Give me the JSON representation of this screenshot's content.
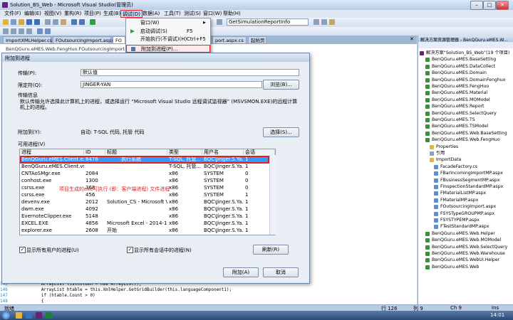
{
  "window": {
    "title": "Solution_BS_Web - Microsoft Visual Studio(管理员)"
  },
  "menu": [
    "文件(F)",
    "编辑(E)",
    "视图(V)",
    "重构(R)",
    "项目(P)",
    "生成(B)",
    "调试(D)",
    "数据(A)",
    "工具(T)",
    "测试(S)",
    "窗口(W)",
    "帮助(H)"
  ],
  "toolbar": {
    "config": "GetSimulationReportInfo"
  },
  "debug_menu": [
    {
      "label": "窗口(W)",
      "shortcut": "",
      "arrow": "▶"
    },
    {
      "label": "启动调试(S)",
      "shortcut": "F5"
    },
    {
      "label": "开始执行(不调试)(H)",
      "shortcut": "Ctrl+F5"
    },
    {
      "label": "附加到进程(P)...",
      "shortcut": ""
    }
  ],
  "tabs": [
    "ImportXMLHelper.cs",
    "FOutsourcingImport.aspx",
    "FO",
    "port.aspx.cs",
    "起始页"
  ],
  "tab_path": "BenQGuru.eMES.Web.FengHuo.FOutsourcingImport",
  "dialog": {
    "title": "附加到进程",
    "transport_label": "传输(P):",
    "transport_value": "默认值",
    "qualifier_label": "限定符(Q):",
    "qualifier_value": "JINGER-YAN",
    "browse_button": "浏览(B)...",
    "info_title": "传输信息",
    "info_text": "默认传输允许选择此计算机上的进程，或选择运行 “Microsoft Visual Studio 远程调试监视器” (MSVSMON.EXE)的远程计算机上的进程。",
    "attach_to_label": "附加到(Y):",
    "attach_to_value": "自动: T-SQL 代码, 托管 代码",
    "select_button": "选择(S)...",
    "available_label": "可用进程(V)",
    "columns": [
      "进程",
      "ID",
      "标题",
      "类型",
      "用户名",
      "会话"
    ],
    "rows": [
      [
        "BenQGuru.eMES.Client.exe",
        "8476",
        "",
        "T-SQL, 托管...",
        "BQC\\Jinger.S.Ya...",
        "1"
      ],
      [
        "BenQGuru.eMES.Client.vshost.exe",
        "",
        "",
        "T-SQL, 托管...",
        "BQC\\Jinger.S.Ya...",
        "1"
      ],
      [
        "CNTAoSMgr.exe",
        "2084",
        "",
        "x86",
        "SYSTEM",
        "0"
      ],
      [
        "conhost.exe",
        "1300",
        "",
        "x86",
        "SYSTEM",
        "0"
      ],
      [
        "csrss.exe",
        "368",
        "",
        "x86",
        "SYSTEM",
        "0"
      ],
      [
        "csrss.exe",
        "456",
        "",
        "x86",
        "SYSTEM",
        "1"
      ],
      [
        "devenv.exe",
        "2012",
        "Solution_CS - Microsoft Vis...",
        "x86",
        "BQC\\Jinger.S.Ya...",
        "1"
      ],
      [
        "dwm.exe",
        "4092",
        "",
        "x86",
        "BQC\\Jinger.S.Ya...",
        "1"
      ],
      [
        "EvernoteClipper.exe",
        "5148",
        "",
        "x86",
        "BQC\\Jinger.S.Ya...",
        "1"
      ],
      [
        "EXCEL.EXE",
        "4856",
        "Microsoft Excel - 2014-10-...",
        "x86",
        "BQC\\Jinger.S.Ya...",
        "1"
      ],
      [
        "explorer.exe",
        "2608",
        "开始",
        "x86",
        "BQC\\Jinger.S.Ya...",
        "1"
      ]
    ],
    "row0_title": "执行系统",
    "annotation": "项目生成的exe可执行 (即：客户端进程) 文件进程",
    "show_all_users": "显示所有用户的进程(U)",
    "show_all_sessions": "显示所有会话中的进程(N)",
    "refresh_button": "刷新(R)",
    "attach_button": "附加(A)",
    "cancel_button": "取消"
  },
  "code": [
    {
      "num": "145",
      "text": "ArrayList listColumn = new ArrayList();"
    },
    {
      "num": "146",
      "text": "ArrayList htable = this.XmlHelper.GetGridBuilder(this.languageComponent1);"
    },
    {
      "num": "147",
      "text": "if (htable.Count > 0)"
    },
    {
      "num": "148",
      "text": "{"
    }
  ],
  "status": {
    "ready": "就绪",
    "line": "行 126",
    "col": "列 9",
    "ch": "Ch 9",
    "ins": "Ins"
  },
  "solution_explorer": {
    "title": "解决方案资源管理器 - BenQGuru.eMES.W...",
    "items": [
      "解决方案“Solution_BS_Web”(19 个项目)",
      "BenQGuru.eMES.BaseSetting",
      "BenQGuru.eMES.DataCollect",
      "BenQGuru.eMES.Domain",
      "BenQGuru.eMES.DomainFenghuo",
      "BenQGuru.eMES.FengHuo",
      "BenQGuru.eMES.Material",
      "BenQGuru.eMES.MOModel",
      "BenQGuru.eMES.Report",
      "BenQGuru.eMES.SelectQuery",
      "BenQGuru.eMES.TS",
      "BenQGuru.eMES.TSModel",
      "BenQGuru.eMES.Web.BaseSetting",
      "BenQGuru.eMES.Web.FengHuo",
      "Properties",
      "引用",
      "ImportData",
      "FacadeFactory.cs",
      "FBarIncomingImportMP.aspx",
      "FBusinessSegmentMP.aspx",
      "FInspectionStandardMP.aspx",
      "FMaterialListMP.aspx",
      "FMaterialMP.aspx",
      "FOutsourcingImport.aspx",
      "FSYSTypeGROUPMP.aspx",
      "FSYSTYPEMP.aspx",
      "FTestStandardMP.aspx",
      "BenQGuru.eMES.Web.Helper",
      "BenQGuru.eMES.Web.MOModel",
      "BenQGuru.eMES.Web.SelectQuery",
      "BenQGuru.eMES.Web.Warehouse",
      "BenQGuru.eMES.WebUI.Helper",
      "BenQGuru.eMES.Web"
    ]
  },
  "taskbar": {
    "time": "14:01"
  }
}
